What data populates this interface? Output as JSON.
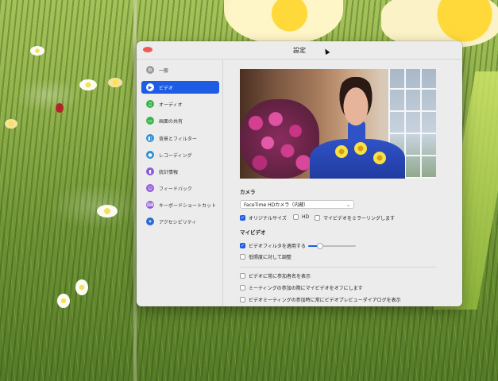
{
  "window": {
    "title": "設定"
  },
  "sidebar": {
    "items": [
      {
        "label": "一般",
        "icon": "gear-icon",
        "color": "#9a9a9a",
        "active": false
      },
      {
        "label": "ビデオ",
        "icon": "video-camera-icon",
        "color": "#1f5ce6",
        "active": true
      },
      {
        "label": "オーディオ",
        "icon": "headphones-icon",
        "color": "#3cb44b",
        "active": false
      },
      {
        "label": "画面の共有",
        "icon": "screen-share-icon",
        "color": "#3cb44b",
        "active": false
      },
      {
        "label": "背景とフィルター",
        "icon": "background-icon",
        "color": "#2b8fd8",
        "active": false
      },
      {
        "label": "レコーディング",
        "icon": "record-icon",
        "color": "#2b8fd8",
        "active": false
      },
      {
        "label": "統計情報",
        "icon": "statistics-icon",
        "color": "#8e5ad8",
        "active": false
      },
      {
        "label": "フィードバック",
        "icon": "feedback-icon",
        "color": "#8e5ad8",
        "active": false
      },
      {
        "label": "キーボードショートカット",
        "icon": "keyboard-icon",
        "color": "#8e5ad8",
        "active": false
      },
      {
        "label": "アクセシビリティ",
        "icon": "accessibility-icon",
        "color": "#2b6bd8",
        "active": false
      }
    ]
  },
  "video": {
    "camera_section": "カメラ",
    "camera_select": "FaceTime HDカメラ（内蔵）",
    "original_size": {
      "label": "オリジナルサイズ",
      "checked": true
    },
    "hd": {
      "label": "HD",
      "checked": false
    },
    "mirror": {
      "label": "マイビデオをミラーリングします",
      "checked": false
    },
    "my_video_section": "マイビデオ",
    "video_filter": {
      "label": "ビデオフィルタを適用する",
      "checked": true
    },
    "filter_level": 0.25,
    "low_light": {
      "label": "低照度に対して調整",
      "checked": false
    },
    "show_names": {
      "label": "ビデオに常に参加者名を表示",
      "checked": false
    },
    "turn_off_video": {
      "label": "ミーティングの参加の際にマイビデオをオフにします",
      "checked": false
    },
    "preview_dialog": {
      "label": "ビデオミーティングの参加時に常にビデオプレビューダイアログを表示",
      "checked": false
    }
  },
  "colors": {
    "accent": "#1f5ce6",
    "close_button": "#ee5a52"
  }
}
